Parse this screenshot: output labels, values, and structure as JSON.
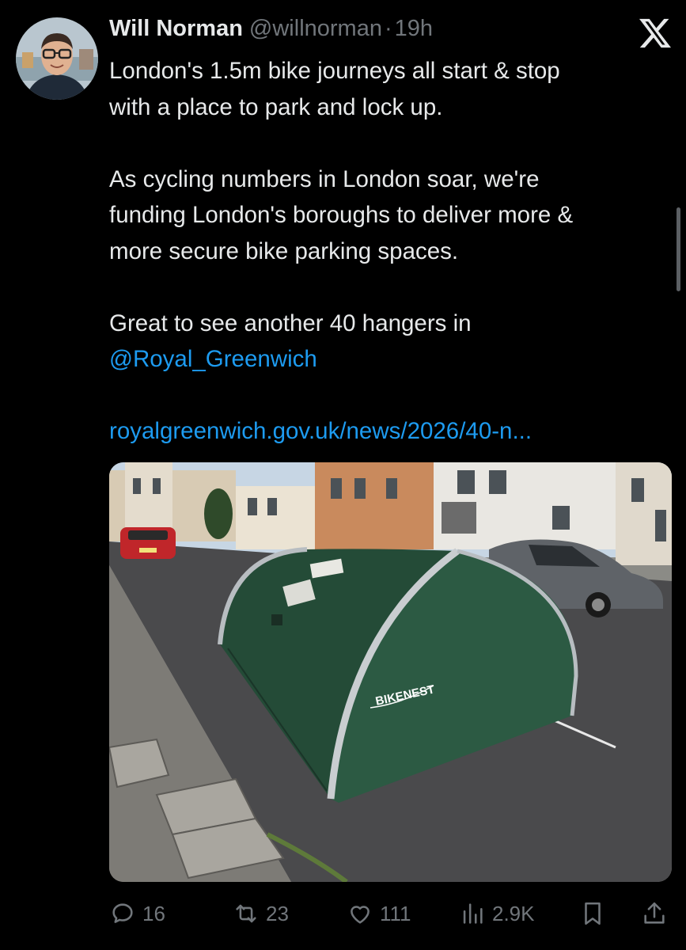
{
  "author": {
    "name": "Will Norman",
    "handle": "@willnorman",
    "separator": "·",
    "time": "19h"
  },
  "tweet": {
    "line1": "London's 1.5m bike journeys all start & stop",
    "line2": "with a place to park and lock up.",
    "line3": "As cycling numbers in London soar, we're",
    "line4": "funding London's boroughs to deliver more &",
    "line5": "more secure bike parking spaces.",
    "line6": "Great to see another 40 hangers in",
    "mention": "@Royal_Greenwich",
    "url": "royalgreenwich.gov.uk/news/2026/40-n..."
  },
  "media": {
    "hangar_brand": "BIKENEST"
  },
  "actions": {
    "replies": "16",
    "reposts": "23",
    "likes": "111",
    "views": "2.9K"
  },
  "colors": {
    "background": "#000000",
    "text": "#e7e9ea",
    "muted": "#71767b",
    "link": "#1d9bf0",
    "hangar_green": "#2c5a43"
  }
}
